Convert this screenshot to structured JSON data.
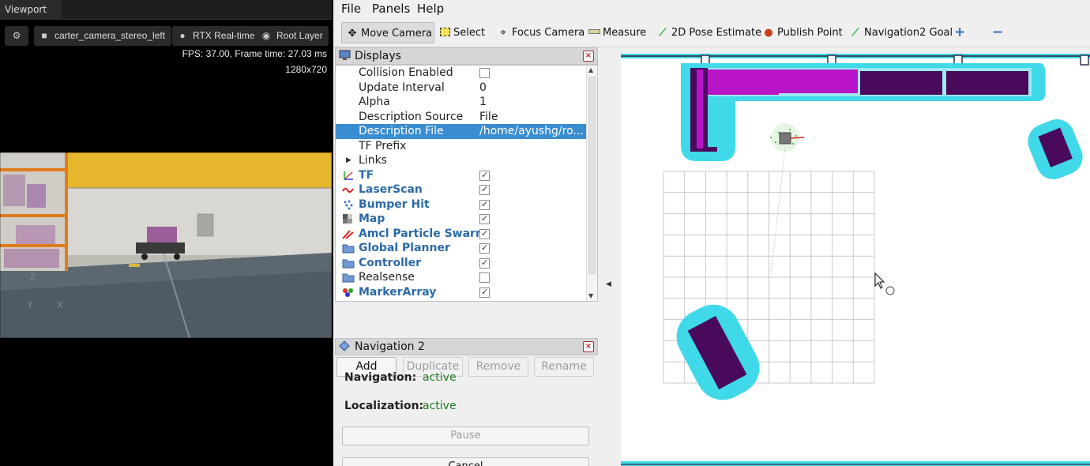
{
  "viewport": {
    "tab_title": "Viewport",
    "buttons": {
      "settings_icon": "gear-icon",
      "camera_label": "carter_camera_stereo_left",
      "render_label": "RTX Real-time",
      "layer_label": "Root Layer"
    },
    "fps_text": "FPS: 37.00, Frame time: 27.03 ms",
    "resolution_text": "1280x720",
    "axis_labels": {
      "z": "Z",
      "y": "Y",
      "x": "X"
    }
  },
  "rviz": {
    "menu": [
      "File",
      "Panels",
      "Help"
    ],
    "tools": {
      "move_camera": "Move Camera",
      "select": "Select",
      "focus_camera": "Focus Camera",
      "measure": "Measure",
      "pose_estimate": "2D Pose Estimate",
      "publish_point": "Publish Point",
      "nav_goal": "Navigation2 Goal"
    },
    "displays": {
      "title": "Displays",
      "properties": [
        {
          "name": "Collision Enabled",
          "value": ""
        },
        {
          "name": "Update Interval",
          "value": "0"
        },
        {
          "name": "Alpha",
          "value": "1"
        },
        {
          "name": "Description Source",
          "value": "File"
        },
        {
          "name": "Description File",
          "value": "/home/ayushg/ro..."
        },
        {
          "name": "TF Prefix",
          "value": ""
        },
        {
          "name": "Links",
          "value": ""
        }
      ],
      "plugins": [
        {
          "name": "TF",
          "checked": true,
          "icon": "tf-icon"
        },
        {
          "name": "LaserScan",
          "checked": true,
          "icon": "laserscan-icon"
        },
        {
          "name": "Bumper Hit",
          "checked": true,
          "icon": "bumper-icon"
        },
        {
          "name": "Map",
          "checked": true,
          "icon": "map-icon"
        },
        {
          "name": "Amcl Particle Swarm",
          "checked": true,
          "icon": "particle-icon"
        },
        {
          "name": "Global Planner",
          "checked": true,
          "icon": "folder-icon"
        },
        {
          "name": "Controller",
          "checked": true,
          "icon": "folder-icon"
        },
        {
          "name": "Realsense",
          "checked": false,
          "icon": "folder-icon"
        },
        {
          "name": "MarkerArray",
          "checked": true,
          "icon": "marker-icon"
        }
      ],
      "buttons": {
        "add": "Add",
        "duplicate": "Duplicate",
        "remove": "Remove",
        "rename": "Rename"
      }
    },
    "navigation": {
      "title": "Navigation 2",
      "navigation_label": "Navigation:",
      "navigation_value": "active",
      "localization_label": "Localization:",
      "localization_value": "active",
      "pause_label": "Pause",
      "cancel_label": "Cancel"
    },
    "colors": {
      "selection": "#3a8dd0",
      "obstacle": "#4a0a5c",
      "obstacle_highlight": "#b814c8",
      "inflation": "#3fd9ea",
      "active_status": "#1f7a1f"
    }
  }
}
